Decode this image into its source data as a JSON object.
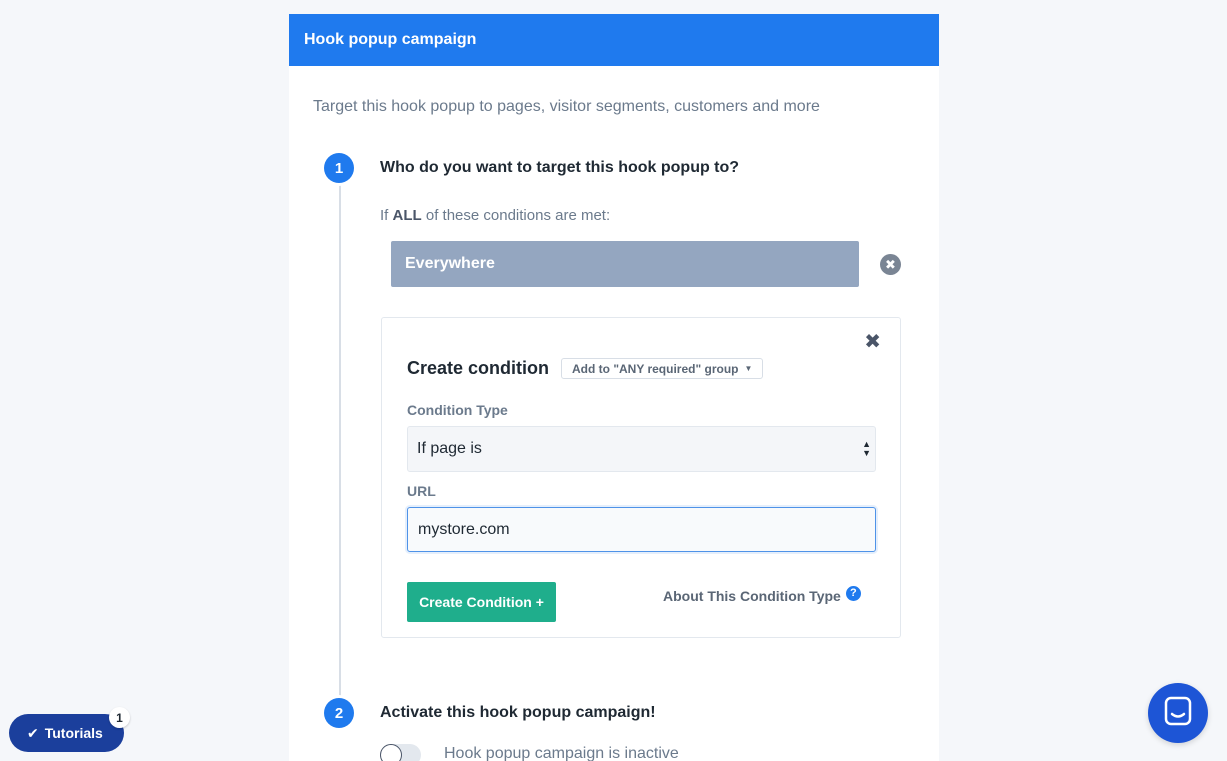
{
  "header": {
    "title": "Hook popup campaign"
  },
  "intro": "Target this hook popup to pages, visitor segments, customers and more",
  "step1": {
    "number": "1",
    "title": "Who do you want to target this hook popup to?",
    "cond_prefix": "If",
    "cond_emphasis": "ALL",
    "cond_suffix": "of these conditions are met:",
    "existing_condition": "Everywhere"
  },
  "create_condition": {
    "title": "Create condition",
    "group_dropdown": "Add to \"ANY required\" group",
    "condition_type_label": "Condition Type",
    "condition_type_value": "If page is",
    "url_label": "URL",
    "url_value": "mystore.com",
    "create_button": "Create Condition +",
    "about_link": "About This Condition Type",
    "help_glyph": "?"
  },
  "step2": {
    "number": "2",
    "title": "Activate this hook popup campaign!",
    "toggle_label": "Hook popup campaign is inactive",
    "toggle_on": false
  },
  "tutorials": {
    "label": "Tutorials",
    "badge": "1"
  },
  "colors": {
    "primary": "#1f7aee",
    "success": "#1fae8c",
    "condition_chip": "#94a6c0",
    "tutorials": "#1b3f9c",
    "chat": "#1d55d6"
  },
  "icons": [
    "close-circle-icon",
    "close-icon",
    "caret-down-icon",
    "select-arrows-icon",
    "help-icon",
    "check-icon",
    "chat-icon"
  ]
}
